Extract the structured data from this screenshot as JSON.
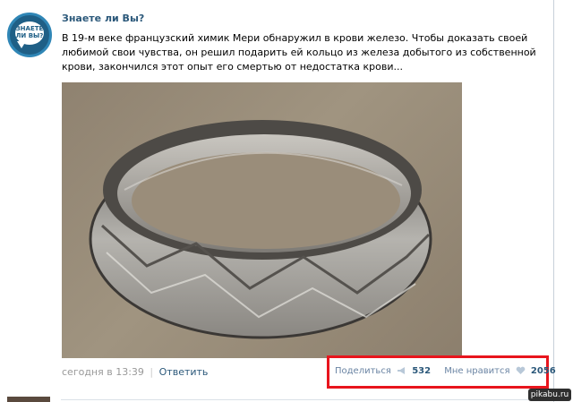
{
  "post": {
    "author": "Знаете ли Вы?",
    "avatar_text": "ЗНАЕТЕ ЛИ ВЫ?",
    "text": "В 19-м веке французский химик Мери обнаружил в крови железо. Чтобы доказать своей любимой свои чувства, он решил подарить ей кольцо из железа добытого из собственной крови, закончился этот опыт его смертью от недостатка крови...",
    "timestamp": "сегодня в 13:39",
    "reply_label": "Ответить",
    "separator": "|"
  },
  "actions": {
    "share_label": "Поделиться",
    "share_count": "532",
    "like_label": "Мне нравится",
    "like_count": "2056"
  },
  "watermark": "pikabu.ru",
  "colors": {
    "link": "#2b587a",
    "muted": "#999999",
    "highlight": "#e8151d"
  }
}
